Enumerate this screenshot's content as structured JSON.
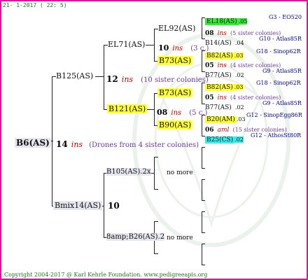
{
  "header": {
    "date": "21- 1-2017 ( 22: 5)"
  },
  "footer": {
    "text": "Copyright 2004-2017 @ Karl Kehrle Foundation.   www.pedigreeapis.org"
  },
  "colors": {
    "border": "#e0149c",
    "highlight_yellow": "#ffff33",
    "highlight_green": "#33ee33",
    "highlight_cyan": "#33eeee",
    "ins_red": "#cc0000",
    "note_purple": "#6a3a9a",
    "ref_blue": "#00008b"
  },
  "root": {
    "name": "B6(AS)",
    "num": "14",
    "ins": "ins",
    "note": "(Drones from 4 sister colonies)"
  },
  "b125": {
    "name": "B125(AS)",
    "num": "12",
    "ins": "ins",
    "note": "(10 sister colonies)"
  },
  "el71": {
    "name": "EL71(AS)"
  },
  "el92": {
    "name": "EL92(AS)",
    "num": "10",
    "ins": "ins",
    "note": "(3 c.)"
  },
  "b73a": {
    "name": "B73(AS)"
  },
  "b121": {
    "name": "B121(AS)",
    "num": "08",
    "ins": "ins",
    "note": "(5 c.)"
  },
  "b73b": {
    "name": "B73(AS)"
  },
  "b90": {
    "name": "B90(AS)"
  },
  "bmix": {
    "name": "Bmix14(AS)",
    "num": "10"
  },
  "b105": {
    "name": "B105(AS).2x",
    "none": "no more"
  },
  "b26": {
    "name": "8amp;B26(AS).2",
    "none": "no more"
  },
  "gen5": [
    {
      "name": "EL18(AS)",
      "suffix": ".05",
      "ref": "G3 - EO520"
    },
    {
      "prefix": "08",
      "ins": "ins",
      "note": "(5 sister colonies)"
    },
    {
      "name": "B14(AS)",
      "suffix": ".04",
      "ref": "G10 - Atlas85R"
    },
    {
      "name": "B82(AS)",
      "suffix": ".03",
      "ref": "G18 - Sinop62R"
    },
    {
      "prefix": "05",
      "ins": "ins",
      "note": "(4 sister colonies)"
    },
    {
      "name": "B77(AS)",
      "suffix": ".02",
      "ref": "G9 - Atlas85R"
    },
    {
      "name": "B82(AS)",
      "suffix": ".03",
      "ref": "G18 - Sinop62R"
    },
    {
      "prefix": "05",
      "ins": "ins",
      "note": "(4 sister colonies)"
    },
    {
      "name": "B77(AS)",
      "suffix": ".02",
      "ref": "G9 - Atlas85R"
    },
    {
      "name": "B20(AM)",
      "suffix": ".03",
      "ref": "G12 - SinopEgg86R"
    },
    {
      "prefix": "06",
      "ins": "aml",
      "note": "(15 sister colonies)"
    },
    {
      "name": "B25(CS)",
      "suffix": ".02",
      "ref": "G12 - AthosSt80R"
    }
  ]
}
